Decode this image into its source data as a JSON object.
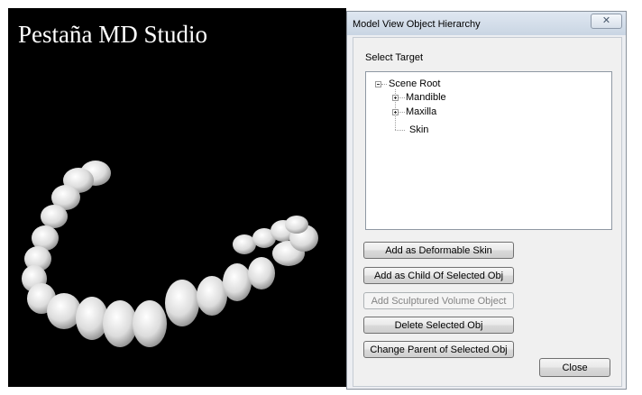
{
  "viewport": {
    "title": "Pestaña MD Studio"
  },
  "dialog": {
    "title": "Model View Object Hierarchy",
    "close_glyph": "✕",
    "group_label": "Select Target",
    "tree": {
      "root": "Scene Root",
      "children": [
        "Mandible",
        "Maxilla",
        "Skin"
      ]
    },
    "buttons": {
      "add_skin": "Add as Deformable Skin",
      "add_child": "Add as Child Of Selected Obj",
      "add_sculpt": "Add Sculptured Volume Object",
      "delete": "Delete Selected Obj",
      "change_parent": "Change Parent of Selected Obj",
      "close": "Close"
    }
  },
  "colors": {
    "viewport_bg": "#000000",
    "teeth": "#e6e6e6",
    "titlebar": "#dfe7f1",
    "dialog_bg": "#f0f0f0"
  }
}
